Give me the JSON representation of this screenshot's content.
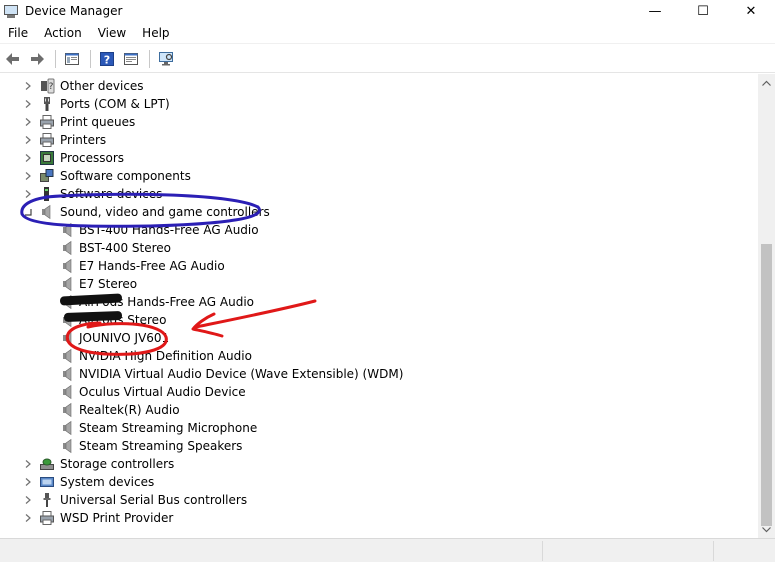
{
  "window": {
    "title": "Device Manager",
    "controls": {
      "minimize": "—",
      "maximize": "☐",
      "close": "✕"
    }
  },
  "menu": [
    "File",
    "Action",
    "View",
    "Help"
  ],
  "tree": [
    {
      "label": "Other devices",
      "icon": "other-devices-icon",
      "expanded": false
    },
    {
      "label": "Ports (COM & LPT)",
      "icon": "port-icon",
      "expanded": false
    },
    {
      "label": "Print queues",
      "icon": "printer-icon",
      "expanded": false
    },
    {
      "label": "Printers",
      "icon": "printer-icon",
      "expanded": false
    },
    {
      "label": "Processors",
      "icon": "processor-icon",
      "expanded": false
    },
    {
      "label": "Software components",
      "icon": "software-components-icon",
      "expanded": false
    },
    {
      "label": "Software devices",
      "icon": "software-device-icon",
      "expanded": false
    },
    {
      "label": "Sound, video and game controllers",
      "icon": "speaker-icon",
      "expanded": true
    },
    {
      "label": "BST-400 Hands-Free AG Audio",
      "icon": "speaker-icon",
      "child": true
    },
    {
      "label": "BST-400 Stereo",
      "icon": "speaker-icon",
      "child": true
    },
    {
      "label": "E7 Hands-Free AG Audio",
      "icon": "speaker-icon",
      "child": true
    },
    {
      "label": "E7 Stereo",
      "icon": "speaker-icon",
      "child": true
    },
    {
      "label": "AirPods Hands-Free AG Audio",
      "icon": "speaker-icon",
      "child": true
    },
    {
      "label": "AirPods Stereo",
      "icon": "speaker-icon",
      "child": true
    },
    {
      "label": "JOUNIVO JV601",
      "icon": "speaker-icon",
      "child": true
    },
    {
      "label": "NVIDIA High Definition Audio",
      "icon": "speaker-icon",
      "child": true
    },
    {
      "label": "NVIDIA Virtual Audio Device (Wave Extensible) (WDM)",
      "icon": "speaker-icon",
      "child": true
    },
    {
      "label": "Oculus Virtual Audio Device",
      "icon": "speaker-icon",
      "child": true
    },
    {
      "label": "Realtek(R) Audio",
      "icon": "speaker-icon",
      "child": true
    },
    {
      "label": "Steam Streaming Microphone",
      "icon": "speaker-icon",
      "child": true
    },
    {
      "label": "Steam Streaming Speakers",
      "icon": "speaker-icon",
      "child": true
    },
    {
      "label": "Storage controllers",
      "icon": "storage-icon",
      "expanded": false
    },
    {
      "label": "System devices",
      "icon": "system-devices-icon",
      "expanded": false
    },
    {
      "label": "Universal Serial Bus controllers",
      "icon": "usb-icon",
      "expanded": false
    },
    {
      "label": "WSD Print Provider",
      "icon": "printer-icon",
      "expanded": false
    }
  ],
  "colors": {
    "annotation_purple": "#2b1fb5",
    "annotation_red": "#e01818"
  }
}
